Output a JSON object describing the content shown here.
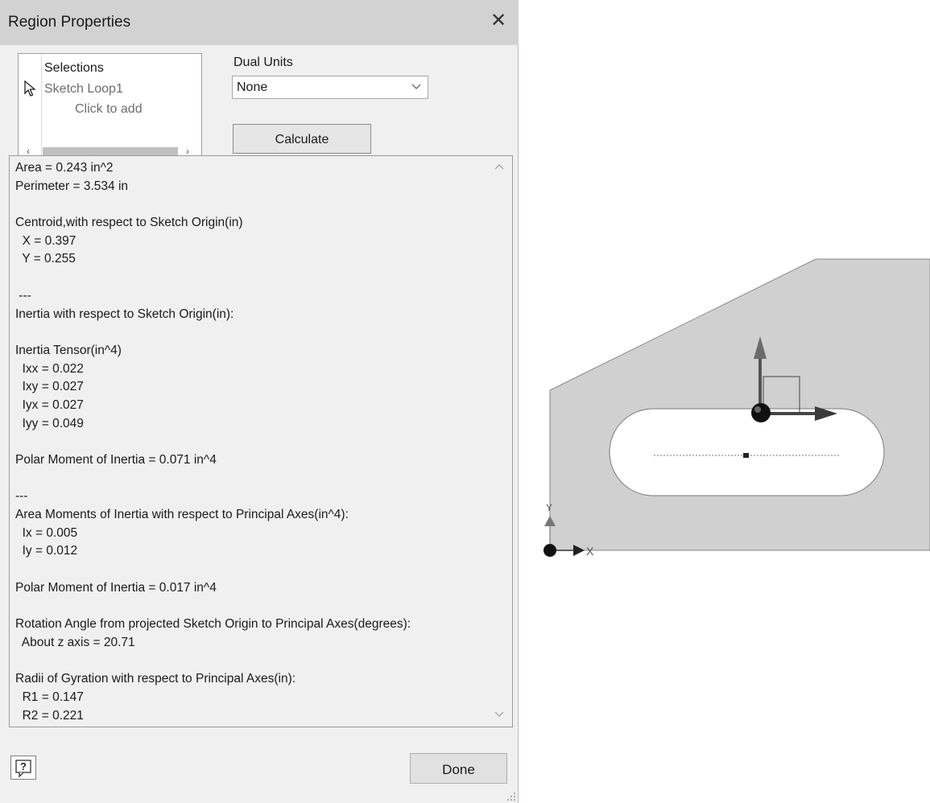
{
  "dialog": {
    "title": "Region Properties",
    "close_glyph": "✕",
    "selections": {
      "header": "Selections",
      "item": "Sketch Loop1",
      "add_hint": "Click to add",
      "scroll_left_glyph": "‹",
      "scroll_right_glyph": "›"
    },
    "dual_units": {
      "label": "Dual Units",
      "value": "None"
    },
    "calculate_label": "Calculate",
    "results": [
      "Area = 0.243 in^2",
      "Perimeter = 3.534 in",
      "",
      "Centroid,with respect to Sketch Origin(in)",
      "  X = 0.397",
      "  Y = 0.255",
      "",
      " ---",
      "Inertia with respect to Sketch Origin(in):",
      "",
      "Inertia Tensor(in^4)",
      "  Ixx = 0.022",
      "  Ixy = 0.027",
      "  Iyx = 0.027",
      "  Iyy = 0.049",
      "",
      "Polar Moment of Inertia = 0.071 in^4",
      "",
      "---",
      "Area Moments of Inertia with respect to Principal Axes(in^4):",
      "  Ix = 0.005",
      "  Iy = 0.012",
      "",
      "Polar Moment of Inertia = 0.017 in^4",
      "",
      "Rotation Angle from projected Sketch Origin to Principal Axes(degrees):",
      "  About z axis = 20.71",
      "",
      "Radii of Gyration with respect to Principal Axes(in):",
      "  R1 = 0.147",
      "  R2 = 0.221"
    ],
    "done_label": "Done",
    "help_icon": "help-icon"
  },
  "canvas": {
    "axis_x_label": "X",
    "axis_y_label": "Y",
    "part_fill": "#d0d0d0"
  },
  "colors": {
    "dialog_bg": "#f0f0f0",
    "titlebar_bg": "#d2d2d2",
    "part_fill": "#d0d0d0"
  }
}
